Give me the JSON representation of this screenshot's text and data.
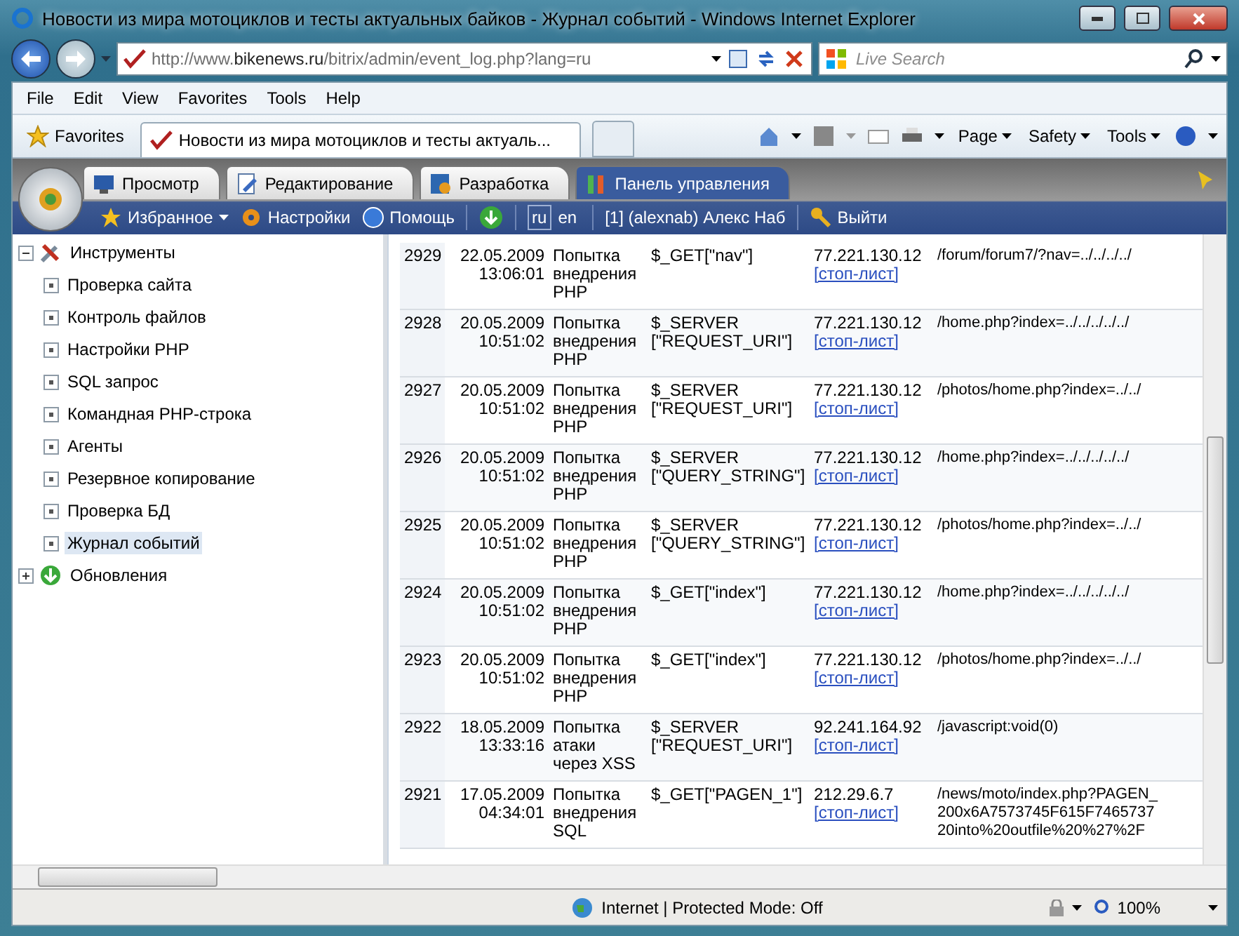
{
  "window": {
    "title": "Новости из мира мотоциклов и тесты актуальных байков - Журнал событий - Windows Internet Explorer"
  },
  "address_bar": {
    "url_prefix": "http://www.",
    "url_host": "bikenews.ru",
    "url_path": "/bitrix/admin/event_log.php?lang=ru"
  },
  "search": {
    "placeholder": "Live Search"
  },
  "menu": [
    "File",
    "Edit",
    "View",
    "Favorites",
    "Tools",
    "Help"
  ],
  "favorites_bar": {
    "favorites": "Favorites",
    "tab_title": "Новости из мира мотоциклов и тесты актуаль...",
    "commands": [
      "Page",
      "Safety",
      "Tools"
    ]
  },
  "admin_tabs": [
    {
      "label": "Просмотр",
      "selected": false
    },
    {
      "label": "Редактирование",
      "selected": false
    },
    {
      "label": "Разработка",
      "selected": false
    },
    {
      "label": "Панель управления",
      "selected": true
    }
  ],
  "admin_toolbar": {
    "favorites": "Избранное",
    "settings": "Настройки",
    "help": "Помощь",
    "languages": [
      {
        "label": "ru",
        "selected": true
      },
      {
        "label": "en",
        "selected": false
      }
    ],
    "user": "[1] (alexnab) Алекс Наб",
    "logout": "Выйти"
  },
  "tree": [
    {
      "label": "Инструменты",
      "expanded": true,
      "selected": false,
      "children": [
        {
          "label": "Проверка сайта",
          "selected": false
        },
        {
          "label": "Контроль файлов",
          "selected": false
        },
        {
          "label": "Настройки PHP",
          "selected": false
        },
        {
          "label": "SQL запрос",
          "selected": false
        },
        {
          "label": "Командная PHP-строка",
          "selected": false
        },
        {
          "label": "Агенты",
          "selected": false
        },
        {
          "label": "Резервное копирование",
          "selected": false
        },
        {
          "label": "Проверка БД",
          "selected": false
        },
        {
          "label": "Журнал событий",
          "selected": true
        }
      ]
    },
    {
      "label": "Обновления",
      "expanded": false,
      "selected": false
    }
  ],
  "table": {
    "rows": [
      {
        "id": "2929",
        "date": "22.05.2009",
        "time": "13:06:01",
        "type": "Попытка внедрения PHP",
        "variable": "$_GET[\"nav\"]",
        "ip": "77.221.130.12",
        "link": "[стоп-лист]",
        "url": "/forum/forum7/?nav=../../../../"
      },
      {
        "id": "2928",
        "date": "20.05.2009",
        "time": "10:51:02",
        "type": "Попытка внедрения PHP",
        "variable": "$_SERVER [\"REQUEST_URI\"]",
        "ip": "77.221.130.12",
        "link": "[стоп-лист]",
        "url": "/home.php?index=../../../../../"
      },
      {
        "id": "2927",
        "date": "20.05.2009",
        "time": "10:51:02",
        "type": "Попытка внедрения PHP",
        "variable": "$_SERVER [\"REQUEST_URI\"]",
        "ip": "77.221.130.12",
        "link": "[стоп-лист]",
        "url": "/photos/home.php?index=../../"
      },
      {
        "id": "2926",
        "date": "20.05.2009",
        "time": "10:51:02",
        "type": "Попытка внедрения PHP",
        "variable": "$_SERVER [\"QUERY_STRING\"]",
        "ip": "77.221.130.12",
        "link": "[стоп-лист]",
        "url": "/home.php?index=../../../../../"
      },
      {
        "id": "2925",
        "date": "20.05.2009",
        "time": "10:51:02",
        "type": "Попытка внедрения PHP",
        "variable": "$_SERVER [\"QUERY_STRING\"]",
        "ip": "77.221.130.12",
        "link": "[стоп-лист]",
        "url": "/photos/home.php?index=../../"
      },
      {
        "id": "2924",
        "date": "20.05.2009",
        "time": "10:51:02",
        "type": "Попытка внедрения PHP",
        "variable": "$_GET[\"index\"]",
        "ip": "77.221.130.12",
        "link": "[стоп-лист]",
        "url": "/home.php?index=../../../../../"
      },
      {
        "id": "2923",
        "date": "20.05.2009",
        "time": "10:51:02",
        "type": "Попытка внедрения PHP",
        "variable": "$_GET[\"index\"]",
        "ip": "77.221.130.12",
        "link": "[стоп-лист]",
        "url": "/photos/home.php?index=../../"
      },
      {
        "id": "2922",
        "date": "18.05.2009",
        "time": "13:33:16",
        "type": "Попытка атаки через XSS",
        "variable": "$_SERVER [\"REQUEST_URI\"]",
        "ip": "92.241.164.92",
        "link": "[стоп-лист]",
        "url": "/javascript:void(0)"
      },
      {
        "id": "2921",
        "date": "17.05.2009",
        "time": "04:34:01",
        "type": "Попытка внедрения SQL",
        "variable": "$_GET[\"PAGEN_1\"]",
        "ip": "212.29.6.7",
        "link": "[стоп-лист]",
        "url": "/news/moto/index.php?PAGEN_",
        "url_more": [
          "200x6A7573745F615F7465737",
          "20into%20outfile%20%27%2F"
        ]
      }
    ]
  },
  "status_bar": {
    "zone": "Internet | Protected Mode: Off",
    "zoom": "100%"
  }
}
